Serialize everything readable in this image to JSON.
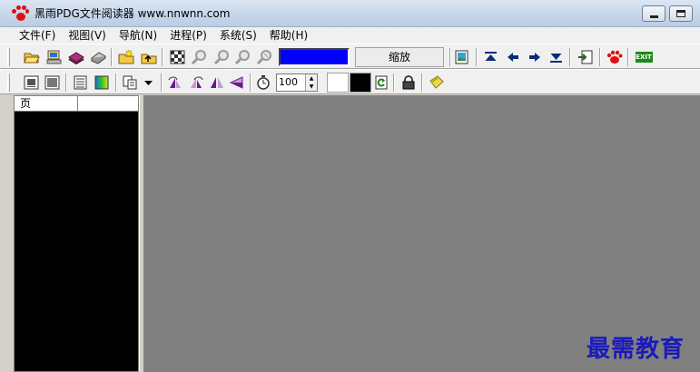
{
  "window": {
    "title": "黑雨PDG文件阅读器 www.nnwnn.com",
    "controls": {
      "minimize_icon": "minimize-icon",
      "restore_icon": "restore-icon"
    }
  },
  "menu": {
    "items": [
      "文件(F)",
      "视图(V)",
      "导航(N)",
      "进程(P)",
      "系统(S)",
      "帮助(H)"
    ]
  },
  "toolbar1": {
    "icons": [
      "open-folder-icon",
      "computer-icon",
      "books-icon",
      "print-icon",
      "new-folder-icon",
      "folder-up-icon",
      "checker-icon",
      "zoom-icon",
      "zoom-in-icon",
      "zoom-out-icon",
      "zoom-fit-icon",
      "image-icon",
      "first-page-icon",
      "prev-page-icon",
      "next-page-icon",
      "last-page-icon",
      "export-icon",
      "paw-icon",
      "exit-icon"
    ],
    "color_swatch": "#0000ff",
    "zoom_label": "缩放",
    "exit_label": "EXIT"
  },
  "toolbar2": {
    "icons": [
      "single-page-icon",
      "fullscreen-icon",
      "list-icon",
      "gradient-icon",
      "copy-icon",
      "dropdown-icon",
      "rotate-left-icon",
      "rotate-right-icon",
      "flip-icon",
      "triangle-icon",
      "timer-icon",
      "refresh-icon",
      "lock-icon",
      "note-icon"
    ],
    "interval_value": "100",
    "foreground_color": "#ffffff",
    "background_color": "#000000"
  },
  "side_panel": {
    "column_header": "页"
  },
  "watermark": "最需教育"
}
